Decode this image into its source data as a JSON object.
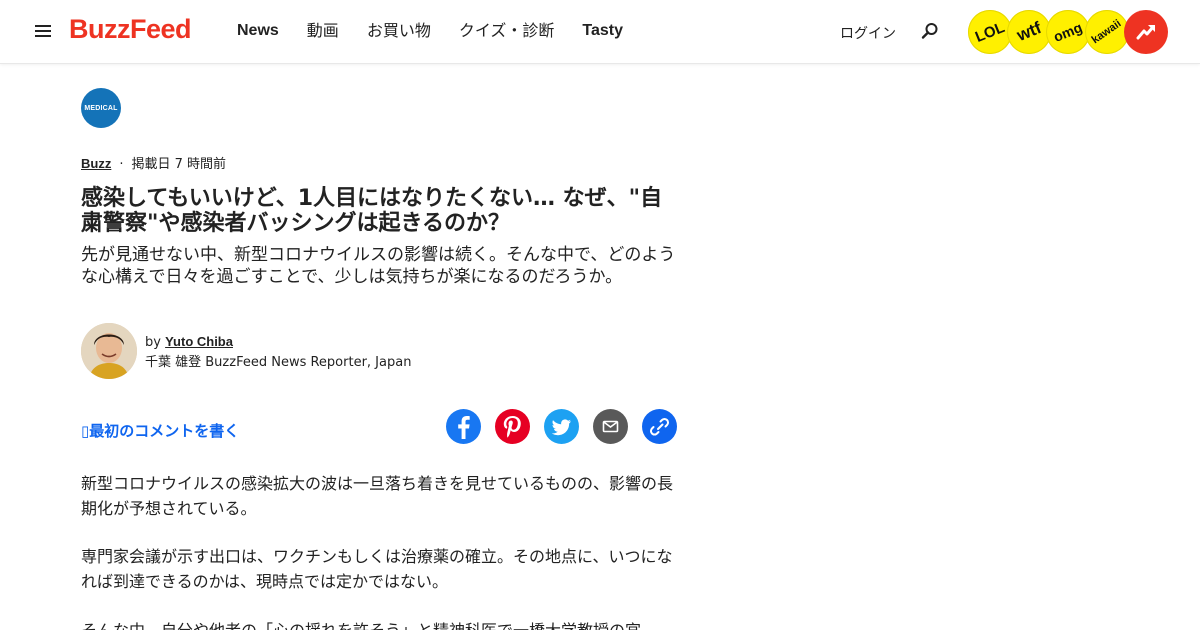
{
  "header": {
    "logo": "BuzzFeed",
    "nav": [
      "News",
      "動画",
      "お買い物",
      "クイズ・診断",
      "Tasty"
    ],
    "login": "ログイン",
    "badges": [
      "LOL",
      "wtf",
      "omg",
      "kawaii"
    ],
    "badge_color": "#fff000",
    "trending_color": "#ee3322",
    "brand_color": "#ee3322"
  },
  "article": {
    "badge_label": "MEDICAL",
    "category": "Buzz",
    "published": "掲載日 7 時間前",
    "title": "感染してもいいけど、1人目にはなりたくない… なぜ、\"自粛警察\"や感染者バッシングは起きるのか？",
    "description": "先が見通せない中、新型コロナウイルスの影響は続く。そんな中で、どのような心構えで日々を過ごすことで、少しは気持ちが楽になるのだろうか。",
    "author": {
      "prefix": "by",
      "name": "Yuto Chiba",
      "role": "千葉 雄登 BuzzFeed News Reporter, Japan"
    },
    "comment_cta": "最初のコメントを書く",
    "share_icons": [
      "facebook-icon",
      "pinterest-icon",
      "twitter-icon",
      "email-icon",
      "link-icon"
    ],
    "paragraphs": [
      "新型コロナウイルスの感染拡大の波は一旦落ち着きを見せているものの、影響の長期化が予想されている。",
      "専門家会議が示す出口は、ワクチンもしくは治療薬の確立。その地点に、いつになれば到達できるのかは、現時点では定かではない。",
      "そんな中、自分や他者の「心の揺れを許そう」と精神科医で一橋大学教授の宮"
    ]
  }
}
